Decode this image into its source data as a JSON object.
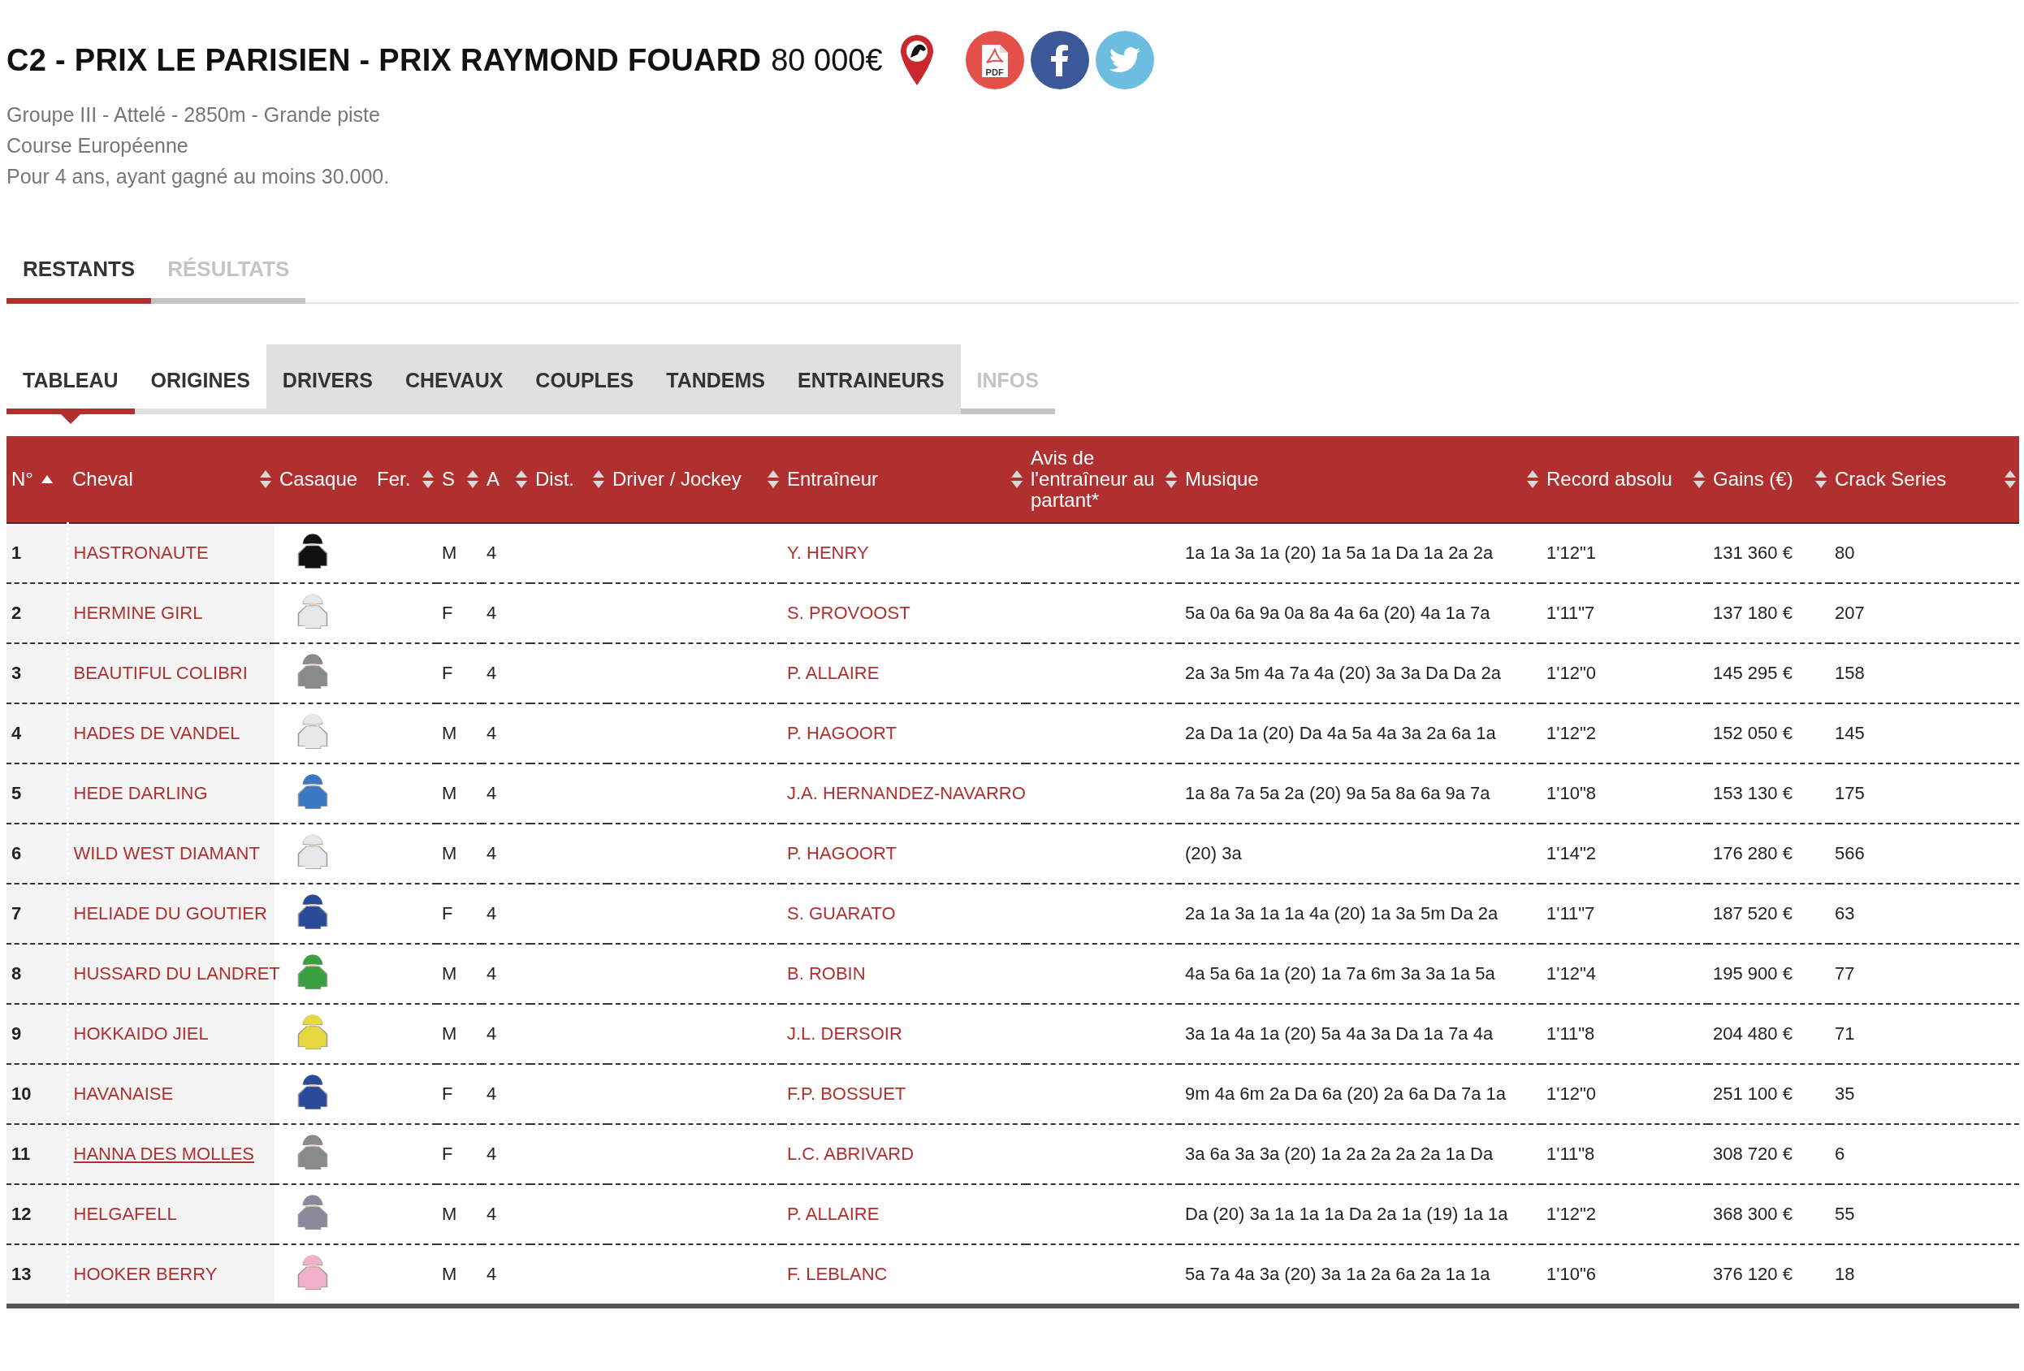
{
  "race": {
    "title": "C2 - PRIX LE PARISIEN - PRIX RAYMOND FOUARD",
    "prize": "80 000€",
    "details": [
      "Groupe III - Attelé - 2850m - Grande piste",
      "Course Européenne",
      "Pour 4 ans, ayant gagné au moins 30.000."
    ],
    "pdf_label": "PDF"
  },
  "tabs": [
    {
      "label": "RESTANTS",
      "selected": true,
      "disabled": false
    },
    {
      "label": "RÉSULTATS",
      "selected": false,
      "disabled": true
    }
  ],
  "subtabs": [
    {
      "label": "TABLEAU",
      "selected": true,
      "kind": "plain",
      "disabled": false
    },
    {
      "label": "ORIGINES",
      "selected": false,
      "kind": "plain",
      "disabled": false
    },
    {
      "label": "DRIVERS",
      "selected": false,
      "kind": "shaded",
      "disabled": false
    },
    {
      "label": "CHEVAUX",
      "selected": false,
      "kind": "shaded",
      "disabled": false
    },
    {
      "label": "COUPLES",
      "selected": false,
      "kind": "shaded",
      "disabled": false
    },
    {
      "label": "TANDEMS",
      "selected": false,
      "kind": "shaded",
      "disabled": false
    },
    {
      "label": "ENTRAINEURS",
      "selected": false,
      "kind": "shaded",
      "disabled": false
    },
    {
      "label": "INFOS",
      "selected": false,
      "kind": "plain",
      "disabled": true
    }
  ],
  "table": {
    "columns": [
      {
        "label": "N°",
        "sortable": true,
        "sorted": true
      },
      {
        "label": "Cheval",
        "sortable": true,
        "sorted": false
      },
      {
        "label": "Casaque",
        "sortable": false
      },
      {
        "label": "Fer.",
        "sortable": true,
        "sorted": false
      },
      {
        "label": "S",
        "sortable": true,
        "sorted": false
      },
      {
        "label": "A",
        "sortable": true,
        "sorted": false
      },
      {
        "label": "Dist.",
        "sortable": true,
        "sorted": false
      },
      {
        "label": "Driver / Jockey",
        "sortable": true,
        "sorted": false
      },
      {
        "label": "Entraîneur",
        "sortable": true,
        "sorted": false
      },
      {
        "label": "Avis de l'entraîneur au partant*",
        "sortable": true,
        "sorted": false
      },
      {
        "label": "Musique",
        "sortable": true,
        "sorted": false
      },
      {
        "label": "Record absolu",
        "sortable": true,
        "sorted": false
      },
      {
        "label": "Gains (€)",
        "sortable": true,
        "sorted": false
      },
      {
        "label": "Crack Series",
        "sortable": true,
        "sorted": false
      }
    ],
    "rows": [
      {
        "num": "1",
        "horse": "HASTRONAUTE",
        "hovered": false,
        "color": "#111111",
        "sex": "M",
        "age": "4",
        "trainer": "Y. HENRY",
        "music": "1a 1a 3a 1a (20) 1a 5a 1a Da 1a 2a 2a",
        "record": "1'12\"1",
        "gains": "131 360 €",
        "crack": "80"
      },
      {
        "num": "2",
        "horse": "HERMINE GIRL",
        "hovered": false,
        "color": "#e8e8e8",
        "sex": "F",
        "age": "4",
        "trainer": "S. PROVOOST",
        "music": "5a 0a 6a 9a 0a 8a 4a 6a (20) 4a 1a 7a",
        "record": "1'11\"7",
        "gains": "137 180 €",
        "crack": "207"
      },
      {
        "num": "3",
        "horse": "BEAUTIFUL COLIBRI",
        "hovered": false,
        "color": "#8a8a8a",
        "sex": "F",
        "age": "4",
        "trainer": "P. ALLAIRE",
        "music": "2a 3a 5m 4a 7a 4a (20) 3a 3a Da Da 2a",
        "record": "1'12\"0",
        "gains": "145 295 €",
        "crack": "158"
      },
      {
        "num": "4",
        "horse": "HADES DE VANDEL",
        "hovered": false,
        "color": "#e8e8e8",
        "sex": "M",
        "age": "4",
        "trainer": "P. HAGOORT",
        "music": "2a Da 1a (20) Da 4a 5a 4a 3a 2a 6a 1a",
        "record": "1'12\"2",
        "gains": "152 050 €",
        "crack": "145"
      },
      {
        "num": "5",
        "horse": "HEDE DARLING",
        "hovered": false,
        "color": "#3a78c0",
        "sex": "M",
        "age": "4",
        "trainer": "J.A. HERNANDEZ-NAVARRO",
        "music": "1a 8a 7a 5a 2a (20) 9a 5a 8a 6a 9a 7a",
        "record": "1'10\"8",
        "gains": "153 130 €",
        "crack": "175"
      },
      {
        "num": "6",
        "horse": "WILD WEST DIAMANT",
        "hovered": false,
        "color": "#e8e8e8",
        "sex": "M",
        "age": "4",
        "trainer": "P. HAGOORT",
        "music": "(20) 3a",
        "record": "1'14\"2",
        "gains": "176 280 €",
        "crack": "566"
      },
      {
        "num": "7",
        "horse": "HELIADE DU GOUTIER",
        "hovered": false,
        "color": "#2a4a9a",
        "sex": "F",
        "age": "4",
        "trainer": "S. GUARATO",
        "music": "2a 1a 3a 1a 1a 4a (20) 1a 3a 5m Da 2a",
        "record": "1'11\"7",
        "gains": "187 520 €",
        "crack": "63"
      },
      {
        "num": "8",
        "horse": "HUSSARD DU LANDRET",
        "hovered": false,
        "color": "#3aa040",
        "sex": "M",
        "age": "4",
        "trainer": "B. ROBIN",
        "music": "4a 5a 6a 1a (20) 1a 7a 6m 3a 3a 1a 5a",
        "record": "1'12\"4",
        "gains": "195 900 €",
        "crack": "77"
      },
      {
        "num": "9",
        "horse": "HOKKAIDO JIEL",
        "hovered": false,
        "color": "#e8d840",
        "sex": "M",
        "age": "4",
        "trainer": "J.L. DERSOIR",
        "music": "3a 1a 4a 1a (20) 5a 4a 3a Da 1a 7a 4a",
        "record": "1'11\"8",
        "gains": "204 480 €",
        "crack": "71"
      },
      {
        "num": "10",
        "horse": "HAVANAISE",
        "hovered": false,
        "color": "#2a4a9a",
        "sex": "F",
        "age": "4",
        "trainer": "F.P. BOSSUET",
        "music": "9m 4a 6m 2a Da 6a (20) 2a 6a Da 7a 1a",
        "record": "1'12\"0",
        "gains": "251 100 €",
        "crack": "35"
      },
      {
        "num": "11",
        "horse": "HANNA DES MOLLES",
        "hovered": true,
        "color": "#8a8a8a",
        "sex": "F",
        "age": "4",
        "trainer": "L.C. ABRIVARD",
        "music": "3a 6a 3a 3a (20) 1a 2a 2a 2a 2a 1a Da",
        "record": "1'11\"8",
        "gains": "308 720 €",
        "crack": "6"
      },
      {
        "num": "12",
        "horse": "HELGAFELL",
        "hovered": false,
        "color": "#8a8a9a",
        "sex": "M",
        "age": "4",
        "trainer": "P. ALLAIRE",
        "music": "Da (20) 3a 1a 1a 1a Da 2a 1a (19) 1a 1a",
        "record": "1'12\"2",
        "gains": "368 300 €",
        "crack": "55"
      },
      {
        "num": "13",
        "horse": "HOOKER BERRY",
        "hovered": false,
        "color": "#f0b0c8",
        "sex": "M",
        "age": "4",
        "trainer": "F. LEBLANC",
        "music": "5a 7a 4a 3a (20) 3a 1a 2a 6a 2a 1a 1a",
        "record": "1'10\"6",
        "gains": "376 120 €",
        "crack": "18"
      }
    ]
  }
}
